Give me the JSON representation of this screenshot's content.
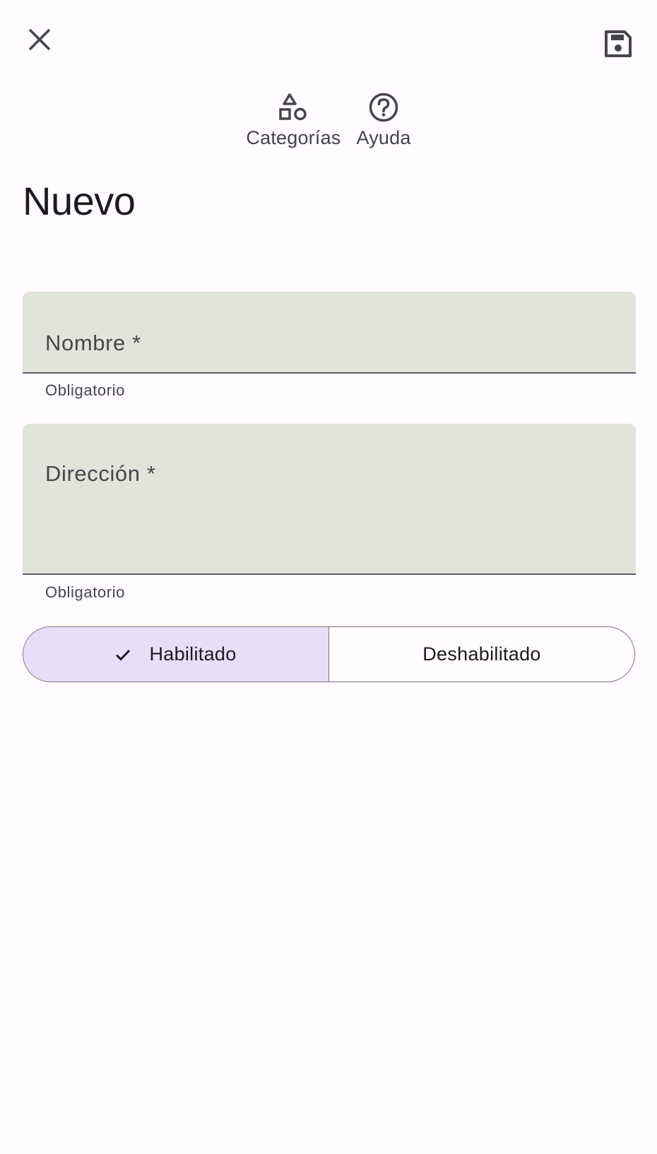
{
  "header": {
    "close_icon": "close-icon",
    "save_icon": "save-icon"
  },
  "actions": [
    {
      "label": "Categorías",
      "icon": "categories-icon"
    },
    {
      "label": "Ayuda",
      "icon": "help-icon"
    }
  ],
  "page_title": "Nuevo",
  "form": {
    "name_field": {
      "label": "Nombre *",
      "helper": "Obligatorio",
      "value": ""
    },
    "address_field": {
      "label": "Dirección *",
      "helper": "Obligatorio",
      "value": ""
    }
  },
  "status_toggle": {
    "options": [
      "Habilitado",
      "Deshabilitado"
    ],
    "selected": "Habilitado"
  },
  "colors": {
    "background": "#fffbfe",
    "field_fill": "#e1e4da",
    "selected_segment": "#e8def8",
    "outline": "#79747e"
  }
}
